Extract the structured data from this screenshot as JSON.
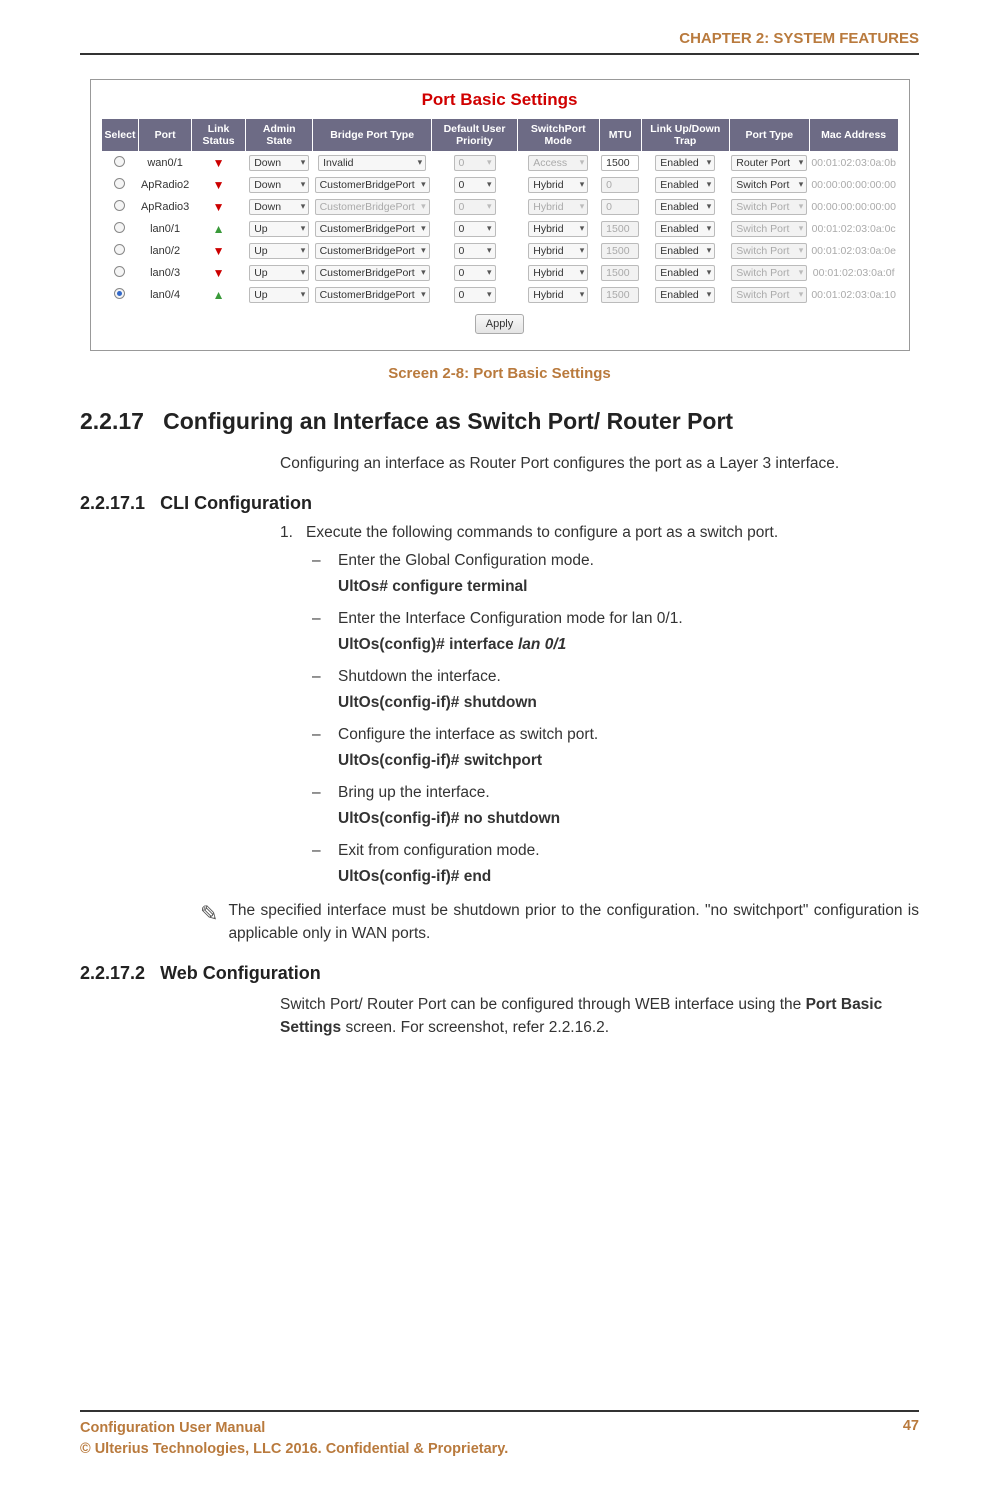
{
  "chapterHeader": "CHAPTER 2: SYSTEM FEATURES",
  "screenshot": {
    "title": "Port Basic Settings",
    "headers": [
      "Select",
      "Port",
      "Link Status",
      "Admin State",
      "Bridge Port Type",
      "Default User Priority",
      "SwitchPort Mode",
      "MTU",
      "Link Up/Down Trap",
      "Port Type",
      "Mac Address"
    ],
    "rows": [
      {
        "selected": false,
        "port": "wan0/1",
        "link": "down",
        "admin": "Down",
        "bridge": {
          "v": "Invalid",
          "d": false
        },
        "prio": {
          "v": "0",
          "d": true
        },
        "spmode": {
          "v": "Access",
          "d": true
        },
        "mtu": {
          "v": "1500",
          "d": false
        },
        "trap": "Enabled",
        "ptype": {
          "v": "Router Port",
          "d": false
        },
        "mac": "00:01:02:03:0a:0b"
      },
      {
        "selected": false,
        "port": "ApRadio2",
        "link": "down",
        "admin": "Down",
        "bridge": {
          "v": "CustomerBridgePort",
          "d": false
        },
        "prio": {
          "v": "0",
          "d": false
        },
        "spmode": {
          "v": "Hybrid",
          "d": false
        },
        "mtu": {
          "v": "0",
          "d": true
        },
        "trap": "Enabled",
        "ptype": {
          "v": "Switch Port",
          "d": false
        },
        "mac": "00:00:00:00:00:00"
      },
      {
        "selected": false,
        "port": "ApRadio3",
        "link": "down",
        "admin": "Down",
        "bridge": {
          "v": "CustomerBridgePort",
          "d": true
        },
        "prio": {
          "v": "0",
          "d": true
        },
        "spmode": {
          "v": "Hybrid",
          "d": true
        },
        "mtu": {
          "v": "0",
          "d": true
        },
        "trap": "Enabled",
        "ptype": {
          "v": "Switch Port",
          "d": true
        },
        "mac": "00:00:00:00:00:00"
      },
      {
        "selected": false,
        "port": "lan0/1",
        "link": "up",
        "admin": "Up",
        "bridge": {
          "v": "CustomerBridgePort",
          "d": false
        },
        "prio": {
          "v": "0",
          "d": false
        },
        "spmode": {
          "v": "Hybrid",
          "d": false
        },
        "mtu": {
          "v": "1500",
          "d": true
        },
        "trap": "Enabled",
        "ptype": {
          "v": "Switch Port",
          "d": true
        },
        "mac": "00:01:02:03:0a:0c"
      },
      {
        "selected": false,
        "port": "lan0/2",
        "link": "down",
        "admin": "Up",
        "bridge": {
          "v": "CustomerBridgePort",
          "d": false
        },
        "prio": {
          "v": "0",
          "d": false
        },
        "spmode": {
          "v": "Hybrid",
          "d": false
        },
        "mtu": {
          "v": "1500",
          "d": true
        },
        "trap": "Enabled",
        "ptype": {
          "v": "Switch Port",
          "d": true
        },
        "mac": "00:01:02:03:0a:0e"
      },
      {
        "selected": false,
        "port": "lan0/3",
        "link": "down",
        "admin": "Up",
        "bridge": {
          "v": "CustomerBridgePort",
          "d": false
        },
        "prio": {
          "v": "0",
          "d": false
        },
        "spmode": {
          "v": "Hybrid",
          "d": false
        },
        "mtu": {
          "v": "1500",
          "d": true
        },
        "trap": "Enabled",
        "ptype": {
          "v": "Switch Port",
          "d": true
        },
        "mac": "00:01:02:03:0a:0f"
      },
      {
        "selected": true,
        "port": "lan0/4",
        "link": "up",
        "admin": "Up",
        "bridge": {
          "v": "CustomerBridgePort",
          "d": false
        },
        "prio": {
          "v": "0",
          "d": false
        },
        "spmode": {
          "v": "Hybrid",
          "d": false
        },
        "mtu": {
          "v": "1500",
          "d": true
        },
        "trap": "Enabled",
        "ptype": {
          "v": "Switch Port",
          "d": true
        },
        "mac": "00:01:02:03:0a:10"
      }
    ],
    "applyLabel": "Apply"
  },
  "screenCaption": "Screen 2-8: Port Basic Settings",
  "section": {
    "num": "2.2.17",
    "title": "Configuring an Interface as Switch Port/ Router Port",
    "intro": "Configuring an interface as Router Port configures the port as a Layer 3 interface."
  },
  "sub1": {
    "num": "2.2.17.1",
    "title": "CLI Configuration",
    "step1": "Execute the following commands to configure a port as a switch port.",
    "items": [
      {
        "text": "Enter the Global Configuration mode.",
        "cmd": "UltOs# configure terminal"
      },
      {
        "text": "Enter the Interface Configuration mode for lan 0/1.",
        "cmdPrefix": "UltOs(config)# interface ",
        "cmdItalic": "lan 0/1"
      },
      {
        "text": "Shutdown the interface.",
        "cmd": "UltOs(config-if)# shutdown"
      },
      {
        "text": "Configure the interface as switch port.",
        "cmd": "UltOs(config-if)# switchport"
      },
      {
        "text": "Bring up the interface.",
        "cmd": "UltOs(config-if)# no shutdown"
      },
      {
        "text": "Exit from configuration mode.",
        "cmd": "UltOs(config-if)# end"
      }
    ],
    "note": "The specified interface must be shutdown prior to the configuration. \"no switchport\" configuration is applicable only in WAN ports."
  },
  "sub2": {
    "num": "2.2.17.2",
    "title": "Web Configuration",
    "body_a": "Switch Port/ Router Port can be configured through WEB interface using the ",
    "body_bold": "Port Basic Settings",
    "body_b": " screen. For screenshot, refer 2.2.16.2."
  },
  "footer": {
    "left1": "Configuration User Manual",
    "left2": "© Ulterius Technologies, LLC 2016. Confidential & Proprietary.",
    "page": "47"
  }
}
